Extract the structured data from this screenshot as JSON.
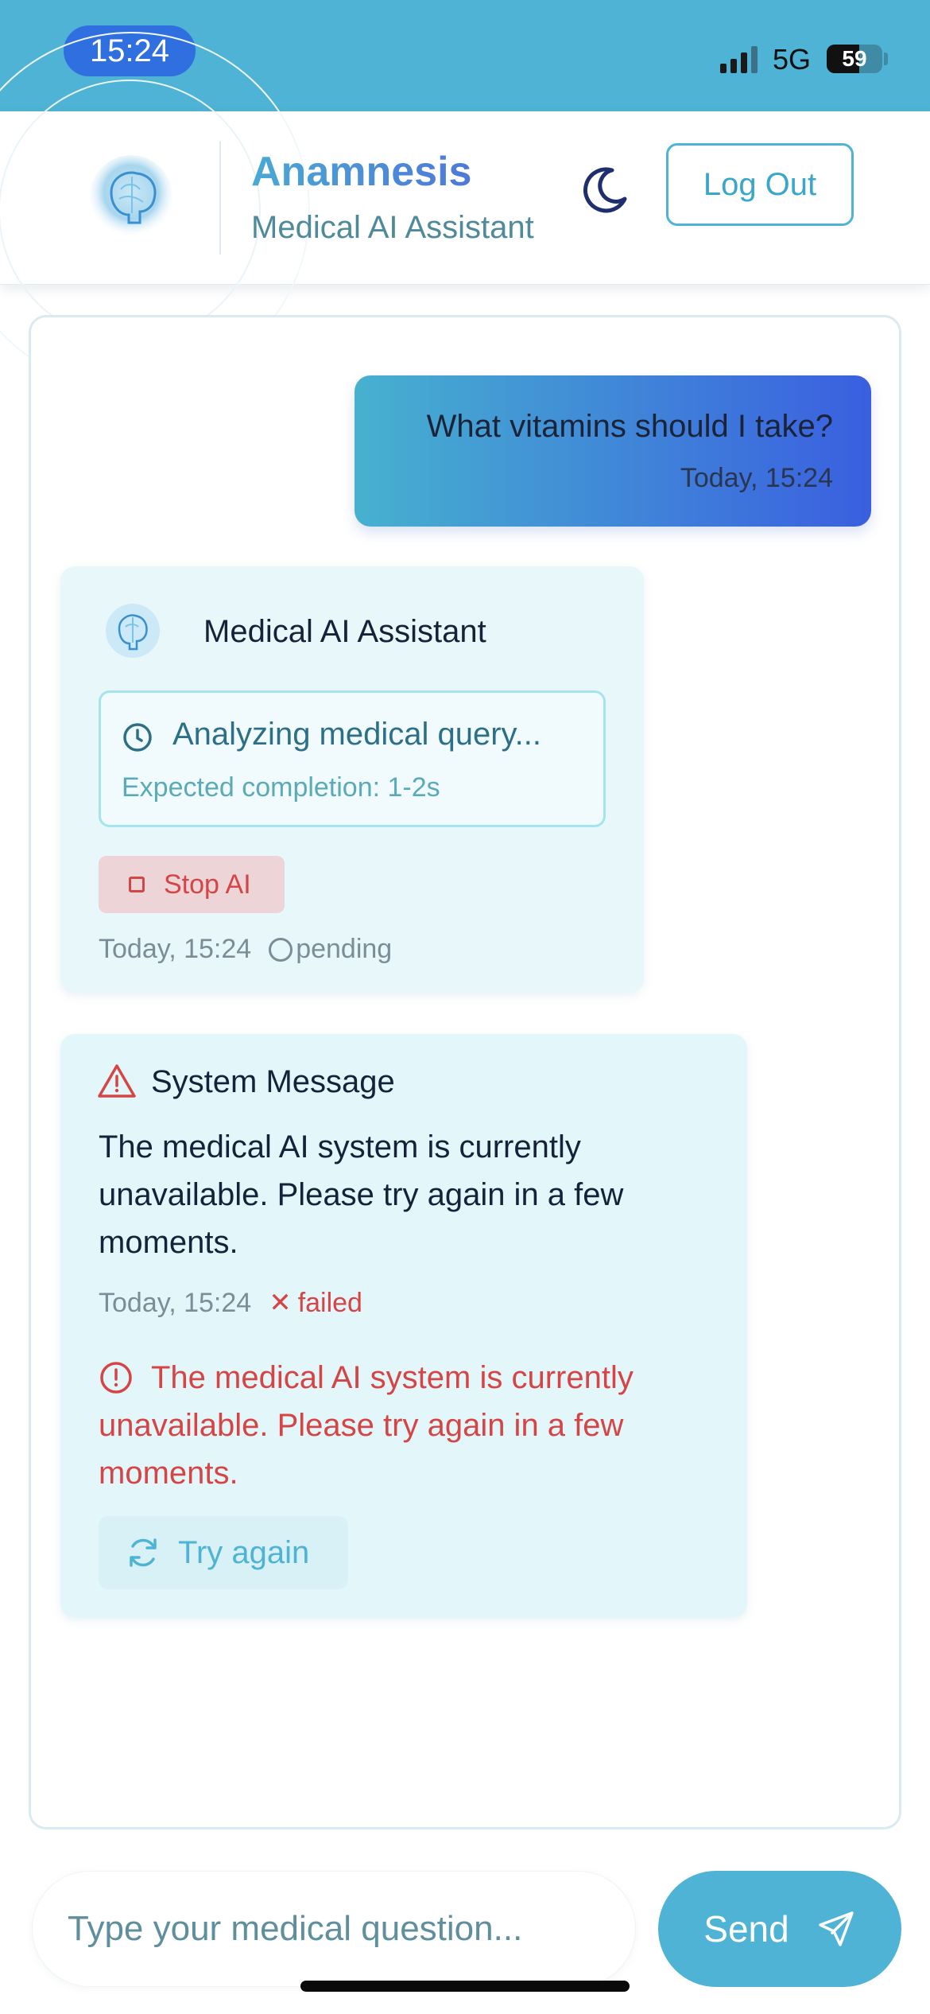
{
  "status_bar": {
    "time": "15:24",
    "network": "5G",
    "battery": "59",
    "battery_level": 0.59
  },
  "header": {
    "app_title": "Anamnesis",
    "app_subtitle": "Medical AI Assistant",
    "logout_label": "Log Out",
    "theme_icon": "moon-icon",
    "logo_icon": "brain-logo-icon"
  },
  "chat": {
    "user_message": {
      "text": "What vitamins should I take?",
      "time": "Today, 15:24"
    },
    "ai_message": {
      "sender": "Medical AI Assistant",
      "status_title": "Analyzing medical query...",
      "status_eta": "Expected completion: 1-2s",
      "stop_label": "Stop AI",
      "time": "Today, 15:24",
      "state": "pending"
    },
    "system_message": {
      "title": "System Message",
      "body": "The medical AI system is currently unavailable. Please try again in a few moments.",
      "time": "Today, 15:24",
      "state": "failed",
      "error_text": "The medical AI system is currently unavailable. Please try again in a few moments.",
      "retry_label": "Try again"
    }
  },
  "composer": {
    "placeholder": "Type your medical question...",
    "send_label": "Send"
  },
  "colors": {
    "accent": "#4fb3d5",
    "user_gradient_start": "#47b1cf",
    "user_gradient_end": "#3a5fe0",
    "error": "#d64545",
    "bubble_bg": "#e8f7fa"
  }
}
